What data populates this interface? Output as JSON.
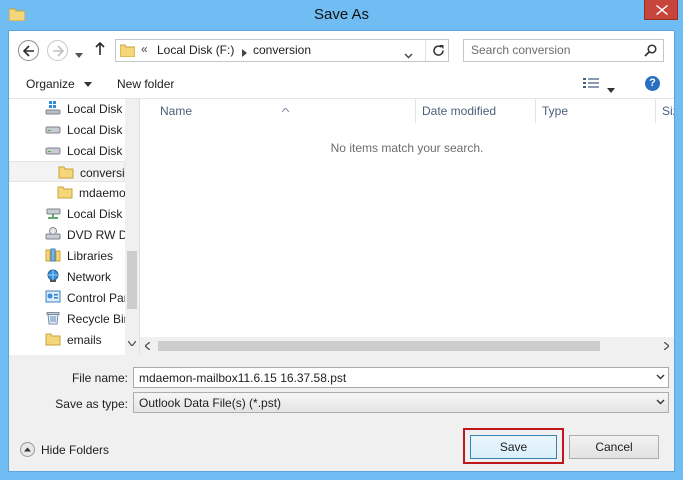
{
  "window": {
    "title": "Save As"
  },
  "navigation": {
    "breadcrumb": [
      "Local Disk (F:)",
      "conversion"
    ],
    "overflow_chevron": "«",
    "search_placeholder": "Search conversion"
  },
  "commandbar": {
    "organize_label": "Organize",
    "new_folder_label": "New folder",
    "help_label": "?"
  },
  "nav_tree": {
    "items": [
      {
        "label": "Local Disk",
        "icon": "windows-drive-icon"
      },
      {
        "label": "Local Disk",
        "icon": "hard-drive-icon"
      },
      {
        "label": "Local Disk",
        "icon": "hard-drive-icon"
      },
      {
        "label": "conversi",
        "icon": "folder-icon",
        "selected": true
      },
      {
        "label": "mdaemo",
        "icon": "folder-icon"
      },
      {
        "label": "Local Disk",
        "icon": "network-drive-icon"
      },
      {
        "label": "DVD RW D",
        "icon": "dvd-drive-icon"
      },
      {
        "label": "Libraries",
        "icon": "libraries-icon"
      },
      {
        "label": "Network",
        "icon": "network-icon"
      },
      {
        "label": "Control Pan",
        "icon": "control-panel-icon"
      },
      {
        "label": "Recycle Bin",
        "icon": "recycle-bin-icon"
      },
      {
        "label": "emails",
        "icon": "folder-icon"
      }
    ]
  },
  "file_list": {
    "columns": [
      "Name",
      "Date modified",
      "Type",
      "Siz"
    ],
    "empty_message": "No items match your search."
  },
  "form": {
    "file_name_label": "File name:",
    "file_name_value": "mdaemon-mailbox11.6.15 16.37.58.pst",
    "save_as_type_label": "Save as type:",
    "save_as_type_value": "Outlook Data File(s) (*.pst)"
  },
  "footer": {
    "hide_folders_label": "Hide Folders",
    "save_label": "Save",
    "cancel_label": "Cancel"
  },
  "colors": {
    "frame": "#6fbdf2",
    "close_button": "#c7453a",
    "save_highlight": "#c0151b",
    "help_icon": "#2a6fc0"
  }
}
